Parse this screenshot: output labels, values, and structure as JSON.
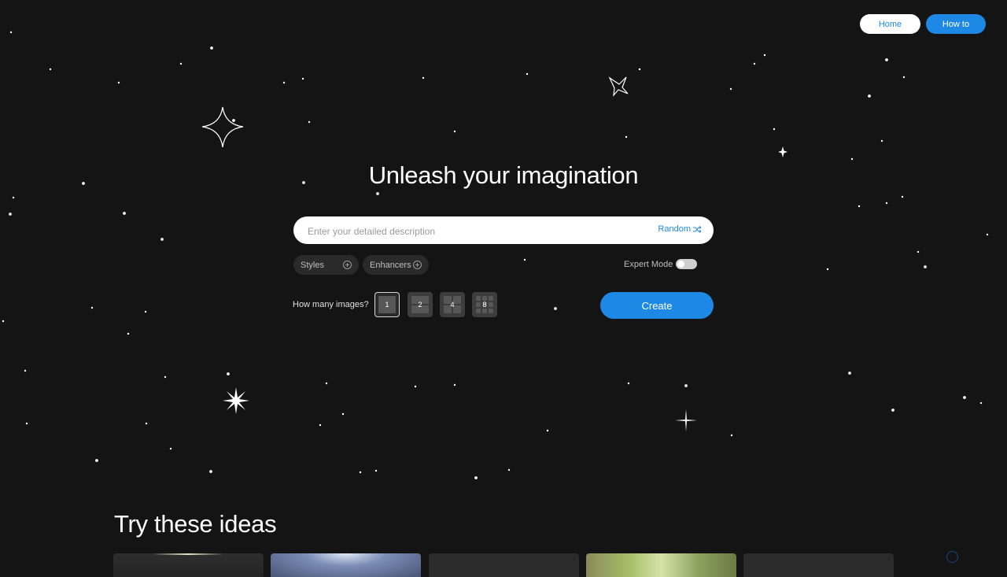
{
  "nav": {
    "home_label": "Home",
    "howto_label": "How to"
  },
  "hero": {
    "title": "Unleash your imagination"
  },
  "prompt": {
    "placeholder": "Enter your detailed description",
    "random_label": "Random"
  },
  "options": {
    "styles_label": "Styles",
    "enhancers_label": "Enhancers",
    "expert_mode_label": "Expert Mode",
    "expert_mode_on": false
  },
  "count": {
    "label": "How many images?",
    "options": [
      "1",
      "2",
      "4",
      "8"
    ],
    "selected": "1"
  },
  "create_label": "Create",
  "ideas": {
    "title": "Try these ideas"
  },
  "colors": {
    "background": "#141414",
    "accent": "#1e88e5"
  }
}
